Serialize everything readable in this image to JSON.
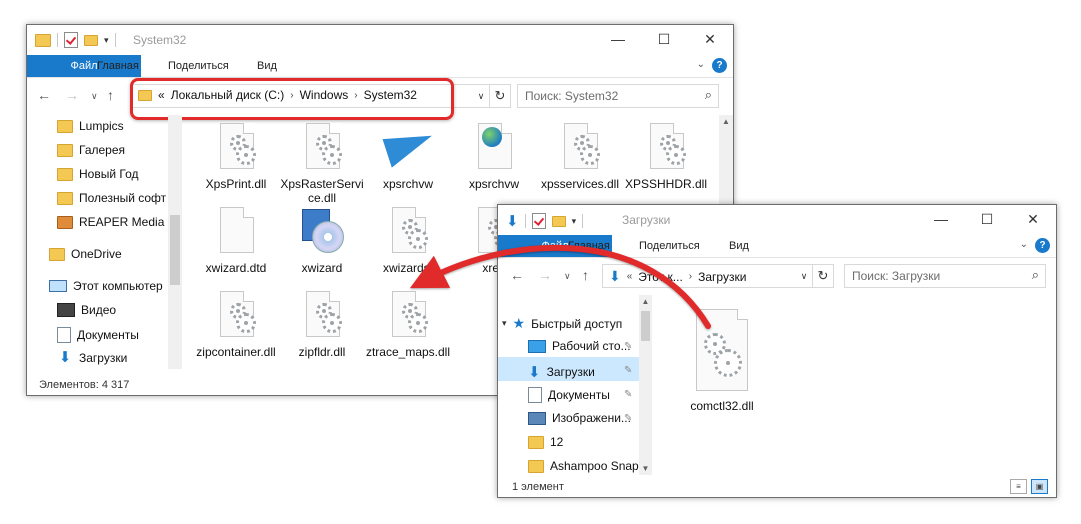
{
  "window1": {
    "title": "System32",
    "controls": {
      "minimize": "—",
      "maximize": "☐",
      "close": "✕"
    },
    "ribbon_tabs": [
      "Файл",
      "Главная",
      "Поделиться",
      "Вид"
    ],
    "help": "?",
    "breadcrumb": {
      "overflow": "«",
      "parts": [
        "Локальный диск (C:)",
        "Windows",
        "System32"
      ]
    },
    "search_placeholder": "Поиск: System32",
    "nav_items": [
      {
        "label": "Lumpics",
        "icon": "folder-icon"
      },
      {
        "label": "Галерея",
        "icon": "folder-icon"
      },
      {
        "label": "Новый Год",
        "icon": "folder-icon"
      },
      {
        "label": "Полезный софт",
        "icon": "folder-icon"
      },
      {
        "label": "REAPER Media",
        "icon": "media-folder-icon"
      },
      {
        "label": "OneDrive",
        "icon": "folder-icon"
      },
      {
        "label": "Этот компьютер",
        "icon": "computer-icon"
      },
      {
        "label": "Видео",
        "icon": "video-icon"
      },
      {
        "label": "Документы",
        "icon": "documents-icon"
      },
      {
        "label": "Загрузки",
        "icon": "downloads-icon"
      }
    ],
    "files": [
      {
        "name": "XpsPrint.dll",
        "icon": "dll-gear-icon"
      },
      {
        "name": "XpsRasterService.dll",
        "icon": "dll-gear-icon"
      },
      {
        "name": "xpsrchvw",
        "icon": "xps-viewer-icon"
      },
      {
        "name": "xpsrchvw",
        "icon": "xml-globe-icon"
      },
      {
        "name": "xpsservices.dll",
        "icon": "dll-gear-icon"
      },
      {
        "name": "XPSSHHDR.dll",
        "icon": "dll-gear-icon"
      },
      {
        "name": "xwizard.dtd",
        "icon": "blank-file-icon"
      },
      {
        "name": "xwizard",
        "icon": "installer-icon"
      },
      {
        "name": "xwizards.",
        "icon": "dll-gear-icon"
      },
      {
        "name": "xreg",
        "icon": "dll-gear-icon"
      },
      {
        "name": "zipcontainer.dll",
        "icon": "dll-gear-icon"
      },
      {
        "name": "zipfldr.dll",
        "icon": "dll-gear-icon"
      },
      {
        "name": "ztrace_maps.dll",
        "icon": "dll-gear-icon"
      }
    ],
    "status": "Элементов: 4 317"
  },
  "window2": {
    "title": "Загрузки",
    "controls": {
      "minimize": "—",
      "maximize": "☐",
      "close": "✕"
    },
    "ribbon_tabs": [
      "Файл",
      "Главная",
      "Поделиться",
      "Вид"
    ],
    "help": "?",
    "breadcrumb": {
      "parts": [
        "Этот к...",
        "Загрузки"
      ]
    },
    "search_placeholder": "Поиск: Загрузки",
    "nav_items": [
      {
        "label": "Быстрый доступ",
        "icon": "star-icon",
        "pinned": false
      },
      {
        "label": "Рабочий сто...",
        "icon": "desktop-icon",
        "pinned": true
      },
      {
        "label": "Загрузки",
        "icon": "downloads-icon",
        "pinned": true,
        "selected": true
      },
      {
        "label": "Документы",
        "icon": "documents-icon",
        "pinned": true
      },
      {
        "label": "Изображени...",
        "icon": "pictures-icon",
        "pinned": true
      },
      {
        "label": "12",
        "icon": "folder-icon",
        "pinned": false
      },
      {
        "label": "Ashampoo Snap",
        "icon": "folder-icon",
        "pinned": false
      }
    ],
    "files": [
      {
        "name": "comctl32.dll",
        "icon": "dll-gear-icon"
      }
    ],
    "status": "1 элемент"
  },
  "colors": {
    "accent": "#1979ca",
    "highlight": "#e12a2a",
    "selected": "#cce8ff"
  }
}
